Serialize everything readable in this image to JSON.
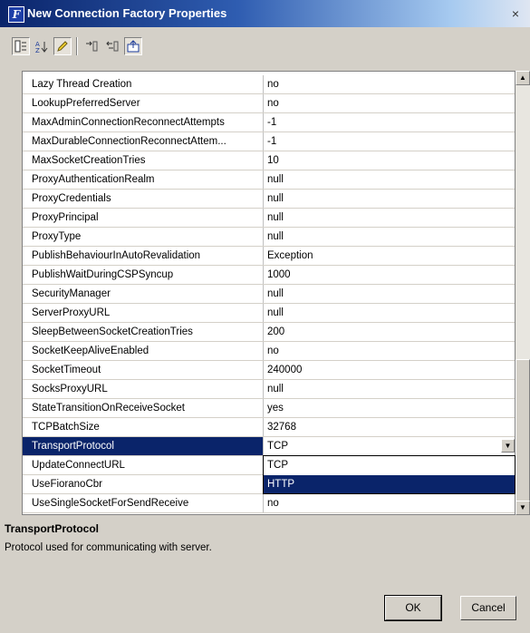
{
  "window": {
    "title": "New Connection Factory Properties",
    "app_icon_letter": "F",
    "close_glyph": "×"
  },
  "toolbar": {
    "buttons": [
      "categorized-view",
      "alphabetical-sort",
      "toggle-edit",
      "expand-all",
      "collapse-all",
      "export"
    ]
  },
  "properties": [
    {
      "name": "Lazy Thread Creation",
      "value": "no"
    },
    {
      "name": "LookupPreferredServer",
      "value": "no"
    },
    {
      "name": "MaxAdminConnectionReconnectAttempts",
      "value": "-1"
    },
    {
      "name": "MaxDurableConnectionReconnectAttem...",
      "value": "-1"
    },
    {
      "name": "MaxSocketCreationTries",
      "value": "10"
    },
    {
      "name": "ProxyAuthenticationRealm",
      "value": "null"
    },
    {
      "name": "ProxyCredentials",
      "value": "null"
    },
    {
      "name": "ProxyPrincipal",
      "value": "null"
    },
    {
      "name": "ProxyType",
      "value": "null"
    },
    {
      "name": "PublishBehaviourInAutoRevalidation",
      "value": "Exception"
    },
    {
      "name": "PublishWaitDuringCSPSyncup",
      "value": "1000"
    },
    {
      "name": "SecurityManager",
      "value": "null"
    },
    {
      "name": "ServerProxyURL",
      "value": "null"
    },
    {
      "name": "SleepBetweenSocketCreationTries",
      "value": "200"
    },
    {
      "name": "SocketKeepAliveEnabled",
      "value": "no"
    },
    {
      "name": "SocketTimeout",
      "value": "240000"
    },
    {
      "name": "SocksProxyURL",
      "value": "null"
    },
    {
      "name": "StateTransitionOnReceiveSocket",
      "value": "yes"
    },
    {
      "name": "TCPBatchSize",
      "value": "32768"
    },
    {
      "name": "TransportProtocol",
      "value": "TCP",
      "selected": true
    },
    {
      "name": "UpdateConnectURL",
      "value": ""
    },
    {
      "name": "UseFioranoCbr",
      "value": ""
    },
    {
      "name": "UseSingleSocketForSendReceive",
      "value": "no"
    }
  ],
  "dropdown": {
    "options": [
      "TCP",
      "HTTP"
    ],
    "highlighted": "HTTP"
  },
  "description": {
    "title": "TransportProtocol",
    "text": "Protocol used for communicating with server."
  },
  "buttons": {
    "ok": "OK",
    "cancel": "Cancel"
  },
  "colors": {
    "selection": "#0a246a",
    "face": "#d4d0c8"
  }
}
